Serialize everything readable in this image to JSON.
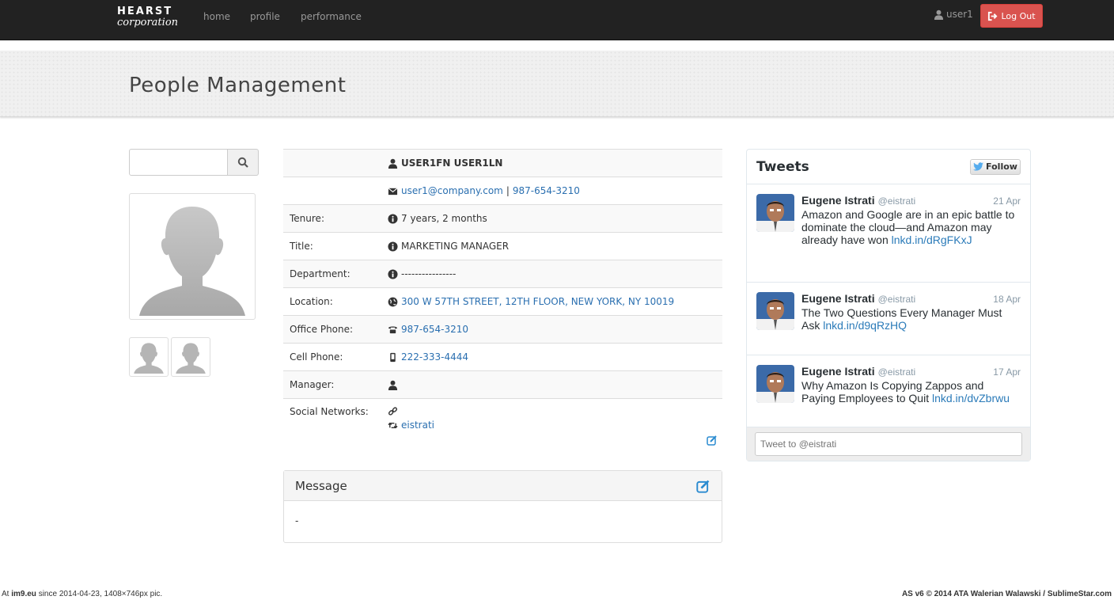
{
  "brand": {
    "line1": "HEARST",
    "line2": "corporation"
  },
  "nav": {
    "home": "home",
    "profile": "profile",
    "performance": "performance"
  },
  "user": {
    "name": "user1",
    "logout_label": "Log Out"
  },
  "page_title": "People Management",
  "search": {
    "placeholder": ""
  },
  "profile": {
    "name": "USER1FN USER1LN",
    "email": "user1@company.com",
    "separator": "|",
    "phone": "987-654-3210",
    "rows": {
      "tenure": {
        "label": "Tenure:",
        "value": "7 years, 2 months"
      },
      "title": {
        "label": "Title:",
        "value": "MARKETING MANAGER"
      },
      "department": {
        "label": "Department:",
        "value": "----------------"
      },
      "location": {
        "label": "Location:",
        "value": "300 W 57TH STREET, 12TH FLOOR, NEW YORK, NY 10019"
      },
      "office_phone": {
        "label": "Office Phone:",
        "value": "987-654-3210"
      },
      "cell_phone": {
        "label": "Cell Phone:",
        "value": "222-333-4444"
      },
      "manager": {
        "label": "Manager:",
        "value": ""
      },
      "social": {
        "label": "Social Networks:",
        "twitter": "eistrati"
      }
    }
  },
  "message": {
    "title": "Message",
    "body": "-"
  },
  "tweets": {
    "title": "Tweets",
    "follow_label": "Follow",
    "items": [
      {
        "name": "Eugene Istrati",
        "handle": "@eistrati",
        "date": "21 Apr",
        "text": "Amazon and Google are in an epic battle to dominate the cloud—and Amazon may already have won",
        "link": "lnkd.in/dRgFKxJ"
      },
      {
        "name": "Eugene Istrati",
        "handle": "@eistrati",
        "date": "18 Apr",
        "text": "The Two Questions Every Manager Must Ask",
        "link": "lnkd.in/d9qRzHQ"
      },
      {
        "name": "Eugene Istrati",
        "handle": "@eistrati",
        "date": "17 Apr",
        "text": "Why Amazon Is Copying Zappos and Paying Employees to Quit",
        "link": "lnkd.in/dvZbrwu"
      }
    ],
    "input_placeholder": "Tweet to @eistrati"
  },
  "footer": {
    "left_prefix": "At ",
    "left_site": "im9.eu",
    "left_rest": "  since 2014-04-23, 1408×746px pic.",
    "right": "AS v6 © 2014 ATA Walerian Walawski / SublimeStar.com"
  },
  "colors": {
    "navbar": "#222222",
    "logout": "#d9534f",
    "link": "#2a6fb0",
    "twitter_link": "#2b7bb9"
  }
}
